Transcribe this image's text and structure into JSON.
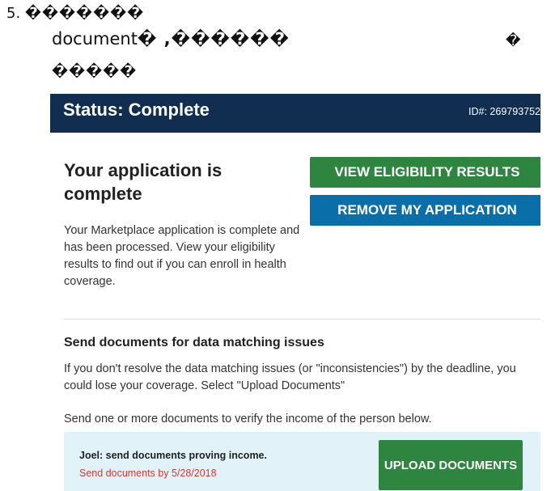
{
  "instruction": {
    "step_number": "5.",
    "step_text": "�������",
    "line2_word": "document",
    "line2_rest": "� ,������",
    "line2_side": "�",
    "line3_text": "�����"
  },
  "status": {
    "title": "Status: Complete",
    "id_label": "ID#: 269793752"
  },
  "application": {
    "heading": "Your application is complete",
    "body": "Your Marketplace application is complete and has been processed. View your eligibility results to find out if you can enroll in health coverage.",
    "view_results_label": "VIEW ELIGIBILITY RESULTS",
    "remove_label": "REMOVE MY APPLICATION"
  },
  "documents": {
    "heading": "Send documents for data matching issues",
    "body": "If you don't resolve the data matching issues (or \"inconsistencies\") by the deadline, you could lose your coverage. Select \"Upload Documents\"",
    "send_text": "Send one or more documents to verify the income of the person below.",
    "person_text": "Joel: send documents proving income.",
    "deadline_text": "Send documents by 5/28/2018",
    "upload_label": "UPLOAD DOCUMENTS"
  },
  "colors": {
    "status_bar": "#112e51",
    "green_button": "#2e8540",
    "blue_button": "#0a6ea8",
    "doc_card_bg": "#e1f3f8",
    "deadline_red": "#d83933"
  }
}
